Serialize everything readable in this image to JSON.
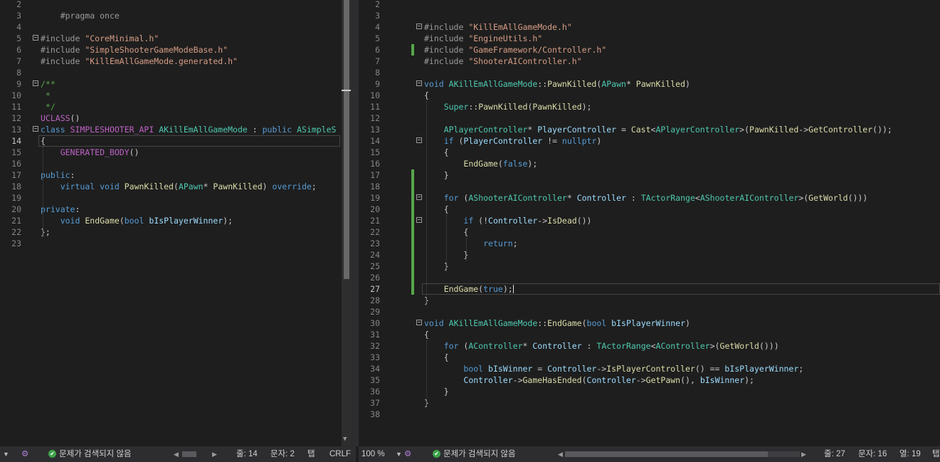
{
  "left_editor": {
    "lines": [
      {
        "n": "2",
        "t": ""
      },
      {
        "n": "3",
        "t": "    #pragma once"
      },
      {
        "n": "4",
        "t": ""
      },
      {
        "n": "5",
        "t": "#include \"CoreMinimal.h\""
      },
      {
        "n": "6",
        "t": "#include \"SimpleShooterGameModeBase.h\""
      },
      {
        "n": "7",
        "t": "#include \"KillEmAllGameMode.generated.h\""
      },
      {
        "n": "8",
        "t": ""
      },
      {
        "n": "9",
        "t": "/**"
      },
      {
        "n": "10",
        "t": " *"
      },
      {
        "n": "11",
        "t": " */"
      },
      {
        "n": "12",
        "t": "UCLASS()"
      },
      {
        "n": "13",
        "t": "class SIMPLESHOOTER_API AKillEmAllGameMode : public ASimpleS"
      },
      {
        "n": "14",
        "t": "{"
      },
      {
        "n": "15",
        "t": "    GENERATED_BODY()"
      },
      {
        "n": "16",
        "t": ""
      },
      {
        "n": "17",
        "t": "public:"
      },
      {
        "n": "18",
        "t": "    virtual void PawnKilled(APawn* PawnKilled) override;"
      },
      {
        "n": "19",
        "t": ""
      },
      {
        "n": "20",
        "t": "private:"
      },
      {
        "n": "21",
        "t": "    void EndGame(bool bIsPlayerWinner);"
      },
      {
        "n": "22",
        "t": "};"
      },
      {
        "n": "23",
        "t": ""
      }
    ],
    "status": {
      "issues": "문제가 검색되지 않음",
      "line": "줄: 14",
      "char": "문자: 2",
      "tab": "탭",
      "eol": "CRLF"
    }
  },
  "right_editor": {
    "lines": [
      {
        "n": "2",
        "t": ""
      },
      {
        "n": "3",
        "t": ""
      },
      {
        "n": "4",
        "t": "#include \"KillEmAllGameMode.h\""
      },
      {
        "n": "5",
        "t": "#include \"EngineUtils.h\""
      },
      {
        "n": "6",
        "t": "#include \"GameFramework/Controller.h\""
      },
      {
        "n": "7",
        "t": "#include \"ShooterAIController.h\""
      },
      {
        "n": "8",
        "t": ""
      },
      {
        "n": "9",
        "t": "void AKillEmAllGameMode::PawnKilled(APawn* PawnKilled)"
      },
      {
        "n": "10",
        "t": "{"
      },
      {
        "n": "11",
        "t": "    Super::PawnKilled(PawnKilled);"
      },
      {
        "n": "12",
        "t": ""
      },
      {
        "n": "13",
        "t": "    APlayerController* PlayerController = Cast<APlayerController>(PawnKilled->GetController());"
      },
      {
        "n": "14",
        "t": "    if (PlayerController != nullptr)"
      },
      {
        "n": "15",
        "t": "    {"
      },
      {
        "n": "16",
        "t": "        EndGame(false);"
      },
      {
        "n": "17",
        "t": "    }"
      },
      {
        "n": "18",
        "t": ""
      },
      {
        "n": "19",
        "t": "    for (AShooterAIController* Controller : TActorRange<AShooterAIController>(GetWorld()))"
      },
      {
        "n": "20",
        "t": "    {"
      },
      {
        "n": "21",
        "t": "        if (!Controller->IsDead())"
      },
      {
        "n": "22",
        "t": "        {"
      },
      {
        "n": "23",
        "t": "            return;"
      },
      {
        "n": "24",
        "t": "        }"
      },
      {
        "n": "25",
        "t": "    }"
      },
      {
        "n": "26",
        "t": ""
      },
      {
        "n": "27",
        "t": "    EndGame(true);"
      },
      {
        "n": "28",
        "t": "}"
      },
      {
        "n": "29",
        "t": ""
      },
      {
        "n": "30",
        "t": "void AKillEmAllGameMode::EndGame(bool bIsPlayerWinner)"
      },
      {
        "n": "31",
        "t": "{"
      },
      {
        "n": "32",
        "t": "    for (AController* Controller : TActorRange<AController>(GetWorld()))"
      },
      {
        "n": "33",
        "t": "    {"
      },
      {
        "n": "34",
        "t": "        bool bIsWinner = Controller->IsPlayerController() == bIsPlayerWinner;"
      },
      {
        "n": "35",
        "t": "        Controller->GameHasEnded(Controller->GetPawn(), bIsWinner);"
      },
      {
        "n": "36",
        "t": "    }"
      },
      {
        "n": "37",
        "t": "}"
      },
      {
        "n": "38",
        "t": ""
      }
    ],
    "status": {
      "zoom": "100 %",
      "issues": "문제가 검색되지 않음",
      "line": "줄: 27",
      "char": "문자: 16",
      "col": "열: 19",
      "tab": "탭"
    }
  },
  "colors": {
    "background": "#1e1e1e",
    "keyword": "#569cd6",
    "type": "#4ec9b0",
    "function": "#dcdcaa",
    "string": "#d69d85",
    "comment": "#57a64a",
    "change_bar": "#57a64a"
  }
}
